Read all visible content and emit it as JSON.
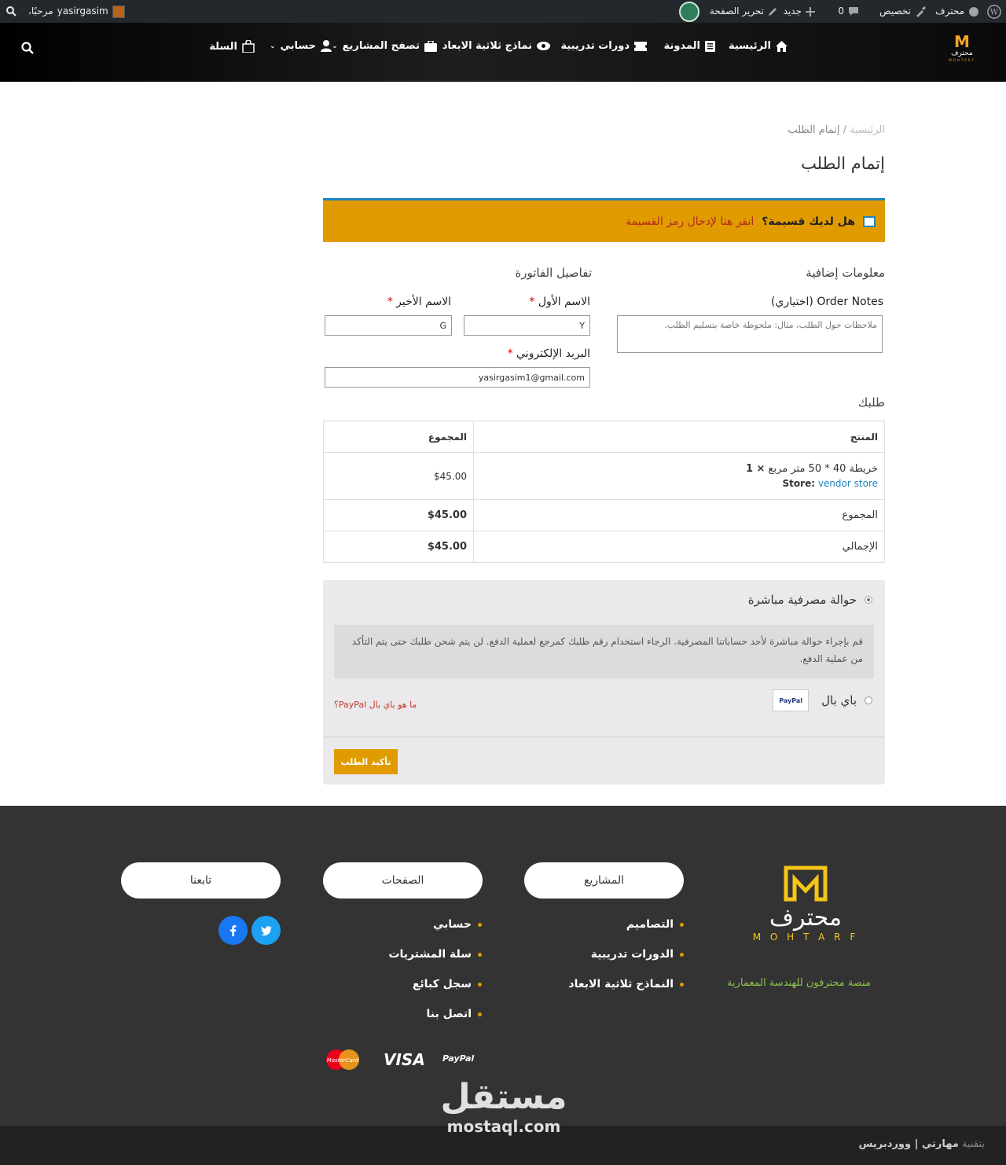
{
  "adminbar": {
    "site_name": "محترف",
    "customize": "تخصيص",
    "comments_count": "0",
    "new": "جديد",
    "edit_page": "تحرير الصفحة",
    "greeting": "مرحبًا،",
    "username": "yasirgasim"
  },
  "nav": {
    "logo_text": "محترف",
    "logo_sub": "MOHTARF",
    "home": "الرئيسية",
    "blog": "المدونة",
    "courses": "دورات تدريبية",
    "models": "نماذج ثلاثية الابعاد",
    "browse_projects": "تصفح المشاريع",
    "account": "حسابي",
    "cart": "السلة"
  },
  "breadcrumb": {
    "home": "الرئيسية",
    "separator": "/",
    "current": "إتمام الطلب"
  },
  "page_title": "إتمام الطلب",
  "coupon": {
    "question": "هل لديك قسيمة؟",
    "link": "انقر هنا لإدخال رمز القسيمة"
  },
  "additional": {
    "heading": "معلومات إضافية",
    "notes_label": "Order Notes (اختياري)",
    "notes_placeholder": "ملاحظات حول الطلب، مثال: ملحوظة خاصة بتسليم الطلب."
  },
  "billing": {
    "heading": "تفاصيل الفاتورة",
    "first_name_label": "الاسم الأول",
    "first_name_value": "Y",
    "last_name_label": "الاسم الأخير",
    "last_name_value": "G",
    "email_label": "البريد الإلكتروني",
    "email_value": "yasirgasim1@gmail.com",
    "required_mark": "*"
  },
  "order": {
    "heading": "طلبك",
    "col_product": "المنتج",
    "col_total": "المجموع",
    "product_name": "خريطة 40 * 50 متر مربع",
    "quantity": "× 1",
    "store_label": "Store:",
    "store_name": "vendor store",
    "product_total": "$45.00",
    "subtotal_label": "المجموع",
    "subtotal_value": "$45.00",
    "total_label": "الإجمالي",
    "total_value": "$45.00"
  },
  "payment": {
    "bank_label": "حوالة مصرفية مباشرة",
    "bank_desc": "قم بإجراء حوالة مباشرة لأحد حساباتنا المصرفية. الرجاء استخدام رقم طلبك كمرجع لعملية الدفع. لن يتم شحن طلبك حتى يتم التأكد من عملية الدفع.",
    "paypal_label": "باي بال",
    "paypal_badge": "PayPal",
    "paypal_link": "ما هو باي بال PayPal؟",
    "confirm": "تأكيد الطلب"
  },
  "footer": {
    "logo_text": "محترف",
    "logo_sub": "M O H T A R F",
    "tagline": "منصة محترفون للهندسة المعمارية",
    "projects_title": "المشاريع",
    "projects_links": [
      "التصاميم",
      "الدورات تدريبية",
      "النماذج ثلاثية الابعاد"
    ],
    "pages_title": "الصفحات",
    "pages_links": [
      "حسابي",
      "سلة المشتريات",
      "سجل كبائع",
      "اتصل بنا"
    ],
    "follow_title": "تابعنا",
    "payments": [
      "MasterCard",
      "VISA",
      "PayPal"
    ],
    "credits_prefix": "بتقنية",
    "credits_brand": "مهارتي | ووردبريس"
  },
  "watermark": {
    "arabic": "مستقل",
    "latin": "mostaql.com"
  },
  "colors": {
    "accent": "#e09b00",
    "link_blue": "#1e85be",
    "footer_bg": "#333333",
    "facebook": "#1877f2",
    "twitter": "#1da1f2"
  }
}
